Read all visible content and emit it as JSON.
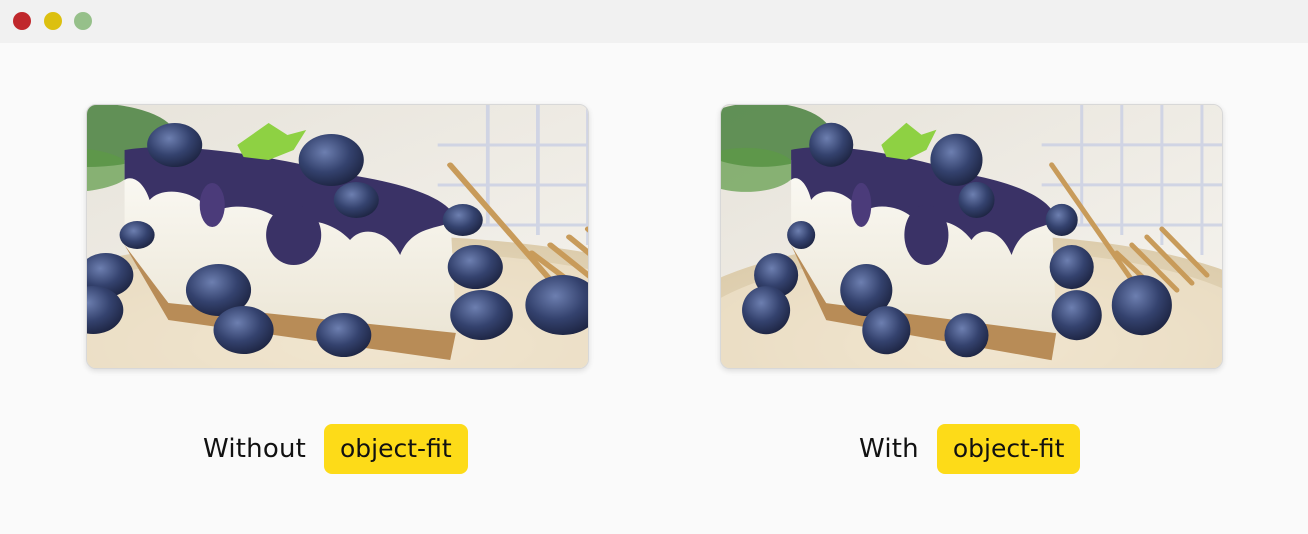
{
  "window": {
    "controls": [
      "close",
      "minimize",
      "zoom"
    ]
  },
  "left_panel": {
    "caption": "Without",
    "code": "object-fit",
    "image_fit": "stretched"
  },
  "right_panel": {
    "caption": "With",
    "code": "object-fit",
    "image_fit": "cover"
  },
  "colors": {
    "badge": "#fddb18",
    "background": "#fafafa",
    "titlebar": "#f1f1f1"
  }
}
